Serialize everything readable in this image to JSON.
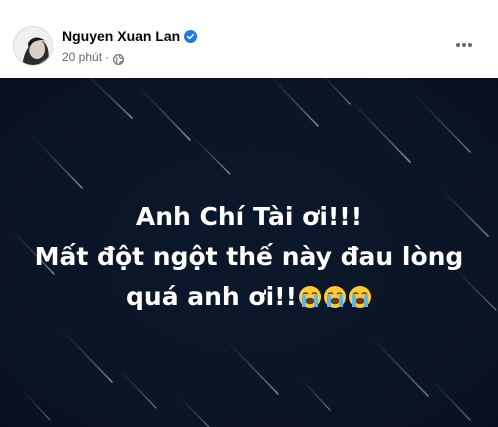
{
  "post": {
    "author": {
      "name": "Nguyen Xuan Lan",
      "verified": true
    },
    "time": "20 phút",
    "separator": "·",
    "audience_icon": "globe-icon",
    "more_icon": "more-horizontal-icon",
    "image": {
      "background": "#0a1628",
      "text_lines": [
        "Anh Chí Tài ơi!!!",
        "Mất đột ngột thế này đau lòng",
        "quá anh ơi!!"
      ],
      "emoji": [
        "loudly-crying-face",
        "loudly-crying-face",
        "loudly-crying-face"
      ]
    }
  },
  "colors": {
    "name": "#050505",
    "secondary_text": "#65676b",
    "verified_blue": "#1877f2",
    "image_bg": "#0a1628",
    "caption": "#ffffff"
  }
}
